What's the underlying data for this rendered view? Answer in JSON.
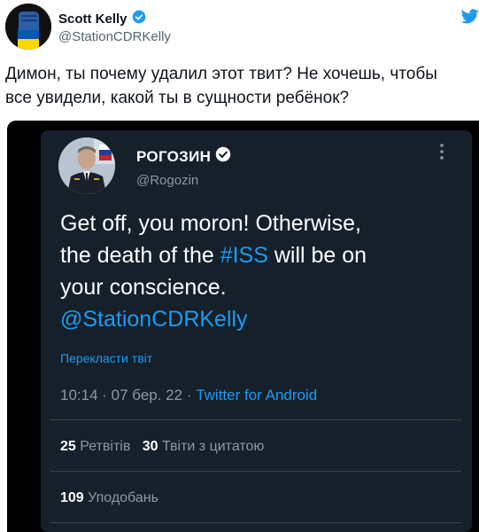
{
  "outer_tweet": {
    "display_name": "Scott Kelly",
    "handle": "@StationCDRKelly",
    "line1": "Димон, ты почему удалил этот твит? Не хочешь, чтобы",
    "line2": "все увидели, какой ты в сущности ребёнок?",
    "icons": [
      "avatar",
      "verified-badge-icon",
      "twitter-bird-icon"
    ]
  },
  "embedded_tweet": {
    "display_name": "РОГОЗИН",
    "handle": "@Rogozin",
    "text_line1": "Get off, you moron!  Otherwise,",
    "text_line2_prefix": "the death of the ",
    "text_line2_link": "#ISS",
    "text_line2_suffix": " will be on",
    "text_line3": "your conscience.",
    "text_line4_link": "@StationCDRKelly",
    "translate_label": "Перекласти твіт",
    "timestamp": "10:14 · 07 бер. 22 · ",
    "source": "Twitter for Android",
    "retweets_count": "25",
    "retweets_label": "Ретвітів",
    "quotes_count": "30",
    "quotes_label": "Твіти з цитатою",
    "likes_count": "109",
    "likes_label": "Уподобань",
    "more_icon": "more-vertical-icon"
  },
  "colors": {
    "link": "#1d9bf0",
    "twitter_blue": "#1d9bf0",
    "dark_bg": "#15202b",
    "muted": "#8b98a5"
  }
}
